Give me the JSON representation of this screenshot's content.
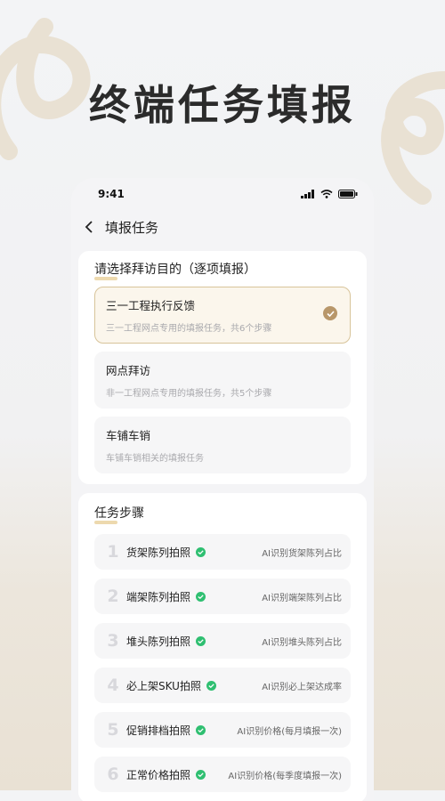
{
  "headline": "终端任务填报",
  "status": {
    "time": "9:41"
  },
  "nav": {
    "title": "填报任务"
  },
  "purpose": {
    "title": "请选择拜访目的（逐项填报）",
    "options": [
      {
        "title": "三一工程执行反馈",
        "desc": "三一工程网点专用的填报任务，共6个步骤",
        "selected": true
      },
      {
        "title": "网点拜访",
        "desc": "非一工程网点专用的填报任务，共5个步骤",
        "selected": false
      },
      {
        "title": "车铺车销",
        "desc": "车铺车销相关的填报任务",
        "selected": false
      }
    ]
  },
  "steps": {
    "title": "任务步骤",
    "items": [
      {
        "num": "1",
        "name": "货架陈列拍照",
        "ai": "AI识别货架陈列占比"
      },
      {
        "num": "2",
        "name": "端架陈列拍照",
        "ai": "AI识别端架陈列占比"
      },
      {
        "num": "3",
        "name": "堆头陈列拍照",
        "ai": "AI识别堆头陈列占比"
      },
      {
        "num": "4",
        "name": "必上架SKU拍照",
        "ai": "AI识别必上架达成率"
      },
      {
        "num": "5",
        "name": "促销排档拍照",
        "ai": "AI识别价格(每月填报一次)"
      },
      {
        "num": "6",
        "name": "正常价格拍照",
        "ai": "AI识别价格(每季度填报一次)"
      }
    ]
  },
  "colors": {
    "accent": "#b8976a",
    "ok": "#2fbf71",
    "selected_bg": "#fbf6ec"
  }
}
